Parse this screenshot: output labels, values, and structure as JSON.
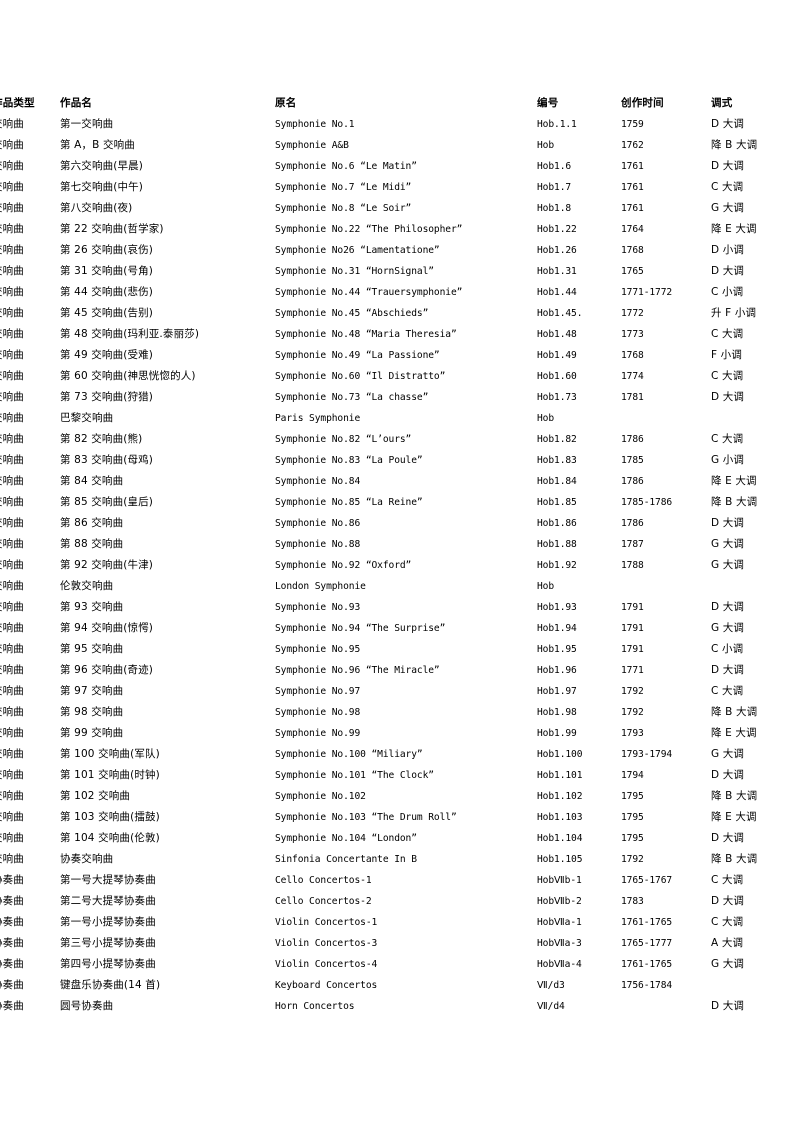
{
  "page": {
    "background_color": "#ffffff",
    "text_color": "#000000"
  },
  "table": {
    "columns": [
      {
        "key": "type",
        "label": "作品类型",
        "clipped_left": true
      },
      {
        "key": "name",
        "label": "作品名"
      },
      {
        "key": "original",
        "label": "原名"
      },
      {
        "key": "catalog",
        "label": "编号"
      },
      {
        "key": "year",
        "label": "创作时间"
      },
      {
        "key": "key",
        "label": "调式"
      }
    ],
    "rows": [
      {
        "type": "交响曲",
        "name": "第一交响曲",
        "original": "Symphonie No.1",
        "catalog": "Hob.1.1",
        "year": "1759",
        "key": "D 大调"
      },
      {
        "type": "交响曲",
        "name": "第 A，B 交响曲",
        "original": "Symphonie A&B",
        "catalog": "Hob",
        "year": "1762",
        "key": "降 B 大调"
      },
      {
        "type": "交响曲",
        "name": "第六交响曲(早晨)",
        "original": "Symphonie No.6  “Le Matin”",
        "catalog": "Hob1.6",
        "year": "1761",
        "key": "D 大调"
      },
      {
        "type": "交响曲",
        "name": "第七交响曲(中午)",
        "original": "Symphonie No.7  “Le Midi”",
        "catalog": "Hob1.7",
        "year": "1761",
        "key": "C 大调"
      },
      {
        "type": "交响曲",
        "name": "第八交响曲(夜)",
        "original": "Symphonie No.8  “Le Soir”",
        "catalog": "Hob1.8",
        "year": "1761",
        "key": "G 大调"
      },
      {
        "type": "交响曲",
        "name": "第 22 交响曲(哲学家)",
        "original": "Symphonie No.22  “The Philosopher”",
        "catalog": "Hob1.22",
        "year": "1764",
        "key": "降 E 大调"
      },
      {
        "type": "交响曲",
        "name": "第 26 交响曲(哀伤)",
        "original": "Symphonie No26  “Lamentatione”",
        "catalog": "Hob1.26",
        "year": "1768",
        "key": "D 小调"
      },
      {
        "type": "交响曲",
        "name": "第 31 交响曲(号角)",
        "original": "Symphonie No.31  “HornSignal”",
        "catalog": "Hob1.31",
        "year": "1765",
        "key": "D 大调"
      },
      {
        "type": "交响曲",
        "name": "第 44 交响曲(悲伤)",
        "original": "Symphonie No.44  “Trauersymphonie”",
        "catalog": "Hob1.44",
        "year": "1771-1772",
        "key": "C 小调"
      },
      {
        "type": "交响曲",
        "name": "第 45 交响曲(告别)",
        "original": "Symphonie No.45  “Abschieds”",
        "catalog": "Hob1.45.",
        "year": "1772",
        "key": "升 F 小调"
      },
      {
        "type": "交响曲",
        "name": "第 48 交响曲(玛利亚.泰丽莎)",
        "original": "Symphonie No.48  “Maria Theresia”",
        "catalog": "Hob1.48",
        "year": "1773",
        "key": "C 大调"
      },
      {
        "type": "交响曲",
        "name": "第 49 交响曲(受难)",
        "original": "Symphonie No.49  “La Passione”",
        "catalog": "Hob1.49",
        "year": "1768",
        "key": "F 小调"
      },
      {
        "type": "交响曲",
        "name": "第 60 交响曲(神思恍惚的人)",
        "original": "Symphonie No.60  “Il Distratto”",
        "catalog": "Hob1.60",
        "year": "1774",
        "key": "C 大调"
      },
      {
        "type": "交响曲",
        "name": "第 73 交响曲(狩猎)",
        "original": "Symphonie No.73  “La chasse”",
        "catalog": "Hob1.73",
        "year": "1781",
        "key": "D 大调"
      },
      {
        "type": "交响曲",
        "name": "巴黎交响曲",
        "original": "Paris Symphonie",
        "catalog": "Hob",
        "year": "",
        "key": ""
      },
      {
        "type": "交响曲",
        "name": "第 82 交响曲(熊)",
        "original": "Symphonie No.82  “L’ours”",
        "catalog": "Hob1.82",
        "year": "1786",
        "key": "C 大调"
      },
      {
        "type": "交响曲",
        "name": "第 83 交响曲(母鸡)",
        "original": "Symphonie No.83  “La Poule”",
        "catalog": "Hob1.83",
        "year": "1785",
        "key": "G 小调"
      },
      {
        "type": "交响曲",
        "name": "第 84 交响曲",
        "original": "Symphonie No.84",
        "catalog": "Hob1.84",
        "year": "1786",
        "key": "降 E 大调"
      },
      {
        "type": "交响曲",
        "name": "第 85 交响曲(皇后)",
        "original": "Symphonie No.85  “La Reine”",
        "catalog": "Hob1.85",
        "year": "1785-1786",
        "key": "降 B 大调"
      },
      {
        "type": "交响曲",
        "name": "第 86 交响曲",
        "original": "Symphonie No.86",
        "catalog": "Hob1.86",
        "year": "1786",
        "key": "D 大调"
      },
      {
        "type": "交响曲",
        "name": "第 88 交响曲",
        "original": "Symphonie No.88",
        "catalog": "Hob1.88",
        "year": "1787",
        "key": "G 大调"
      },
      {
        "type": "交响曲",
        "name": "第 92 交响曲(牛津)",
        "original": "Symphonie No.92  “Oxford”",
        "catalog": "Hob1.92",
        "year": "1788",
        "key": "G 大调"
      },
      {
        "type": "交响曲",
        "name": "伦敦交响曲",
        "original": "London Symphonie",
        "catalog": "Hob",
        "year": "",
        "key": ""
      },
      {
        "type": "交响曲",
        "name": "第 93 交响曲",
        "original": "Symphonie No.93",
        "catalog": "Hob1.93",
        "year": "1791",
        "key": "D 大调"
      },
      {
        "type": "交响曲",
        "name": "第 94 交响曲(惊愕)",
        "original": "Symphonie No.94  “The Surprise”",
        "catalog": "Hob1.94",
        "year": "1791",
        "key": "G 大调"
      },
      {
        "type": "交响曲",
        "name": "第 95 交响曲",
        "original": "Symphonie No.95",
        "catalog": "Hob1.95",
        "year": "1791",
        "key": "C 小调"
      },
      {
        "type": "交响曲",
        "name": "第 96 交响曲(奇迹)",
        "original": "Symphonie No.96  “The Miracle”",
        "catalog": "Hob1.96",
        "year": "1771",
        "key": "D 大调"
      },
      {
        "type": "交响曲",
        "name": "第 97 交响曲",
        "original": "Symphonie No.97",
        "catalog": "Hob1.97",
        "year": "1792",
        "key": "C 大调"
      },
      {
        "type": "交响曲",
        "name": "第 98 交响曲",
        "original": "Symphonie No.98",
        "catalog": "Hob1.98",
        "year": "1792",
        "key": "降 B 大调"
      },
      {
        "type": "交响曲",
        "name": "第 99 交响曲",
        "original": "Symphonie No.99",
        "catalog": "Hob1.99",
        "year": "1793",
        "key": "降 E 大调"
      },
      {
        "type": "交响曲",
        "name": "第 100 交响曲(军队)",
        "original": "Symphonie No.100  “Miliary”",
        "catalog": "Hob1.100",
        "year": "1793-1794",
        "key": "G 大调"
      },
      {
        "type": "交响曲",
        "name": "第 101 交响曲(时钟)",
        "original": "Symphonie No.101  “The Clock”",
        "catalog": "Hob1.101",
        "year": "1794",
        "key": "D 大调"
      },
      {
        "type": "交响曲",
        "name": "第 102 交响曲",
        "original": "Symphonie No.102",
        "catalog": "Hob1.102",
        "year": "1795",
        "key": "降 B 大调"
      },
      {
        "type": "交响曲",
        "name": "第 103 交响曲(擂鼓)",
        "original": "Symphonie No.103  “The Drum Roll”",
        "catalog": "Hob1.103",
        "year": "1795",
        "key": "降 E 大调"
      },
      {
        "type": "交响曲",
        "name": "第 104 交响曲(伦敦)",
        "original": "Symphonie No.104  “London”",
        "catalog": "Hob1.104",
        "year": "1795",
        "key": "D 大调"
      },
      {
        "type": "交响曲",
        "name": "协奏交响曲",
        "original": "Sinfonia Concertante In B",
        "catalog": "Hob1.105",
        "year": "1792",
        "key": "降 B 大调"
      },
      {
        "type": "协奏曲",
        "name": "第一号大提琴协奏曲",
        "original": "Cello Concertos-1",
        "catalog": "HobⅦb-1",
        "year": "1765-1767",
        "key": "C 大调"
      },
      {
        "type": "协奏曲",
        "name": "第二号大提琴协奏曲",
        "original": "Cello Concertos-2",
        "catalog": "HobⅦb-2",
        "year": "1783",
        "key": "D 大调"
      },
      {
        "type": "协奏曲",
        "name": "第一号小提琴协奏曲",
        "original": "Violin Concertos-1",
        "catalog": "HobⅦa-1",
        "year": "1761-1765",
        "key": "C 大调"
      },
      {
        "type": "协奏曲",
        "name": "第三号小提琴协奏曲",
        "original": "Violin Concertos-3",
        "catalog": "HobⅦa-3",
        "year": "1765-1777",
        "key": "A 大调"
      },
      {
        "type": "协奏曲",
        "name": "第四号小提琴协奏曲",
        "original": "Violin Concertos-4",
        "catalog": "HobⅦa-4",
        "year": "1761-1765",
        "key": "G 大调"
      },
      {
        "type": "协奏曲",
        "name": "键盘乐协奏曲(14 首)",
        "original": "Keyboard Concertos",
        "catalog": "Ⅶ/d3",
        "year": "1756-1784",
        "key": ""
      },
      {
        "type": "协奏曲",
        "name": "圆号协奏曲",
        "original": "Horn Concertos",
        "catalog": "Ⅶ/d4",
        "year": "",
        "key": "D 大调"
      }
    ]
  }
}
